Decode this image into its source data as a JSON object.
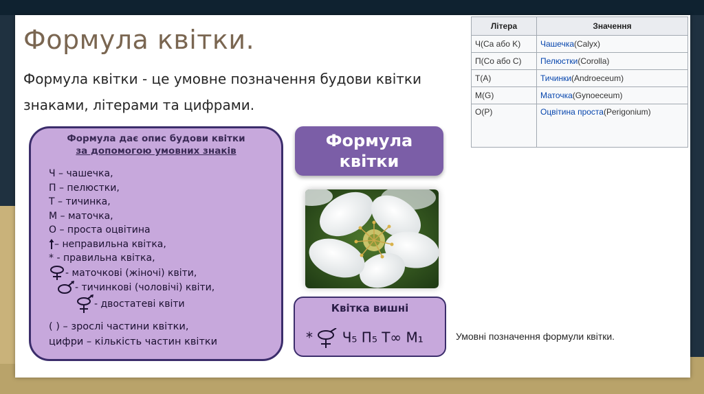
{
  "title": "Формула квітки.",
  "definition": "Формула квітки - це умовне позначення будови квітки знаками, літерами та цифрами.",
  "table": {
    "headers": [
      "Літера",
      "Значення"
    ],
    "rows": [
      {
        "letter": "Ч(Ca або K)",
        "link": "Чашечка",
        "rest": "(Calyx)"
      },
      {
        "letter": "П(Co або C)",
        "link": "Пелюстки",
        "rest": "(Corolla)"
      },
      {
        "letter": "Т(A)",
        "link": "Тичинки",
        "rest": "(Androeceum)"
      },
      {
        "letter": "М(G)",
        "link": "Маточка",
        "rest": "(Gynoeceum)"
      },
      {
        "letter": "О(P)",
        "link": "Оцвітина проста",
        "rest": "(Perigonium)"
      }
    ]
  },
  "legend": {
    "heading_line1": "Формула дає опис будови квітки",
    "heading_line2": "за допомогою умовних знаків",
    "items": [
      "Ч – чашечка,",
      "П – пелюстки,",
      "Т – тичинка,",
      "М – маточка,",
      "О – проста оцвітина"
    ],
    "irregular": "– неправильна квітка,",
    "regular_symbol": "*",
    "regular": "- правильна квітка,",
    "female": "- маточкові (жіночі) квіти,",
    "male": "- тичинкові (чоловічі)  квіти,",
    "bisexual": "- двостатеві квіти",
    "foot_line1": "( ) – зрослі частини квітки,",
    "foot_line2": "цифри – кількість частин квітки"
  },
  "formula_header": {
    "line1": "Формула",
    "line2": "квітки"
  },
  "photo": {
    "icon": "cherry-flower-photo"
  },
  "cherry": {
    "title": "Квітка вишні",
    "star": "*",
    "formula": "Ч₅ П₅ Т∞ М₁"
  },
  "caption": "Умовні позначення формули квітки.",
  "colors": {
    "purple_box": "#c7a8dc",
    "purple_header": "#7b5ea7",
    "title": "#7a6651",
    "link": "#0645ad"
  }
}
